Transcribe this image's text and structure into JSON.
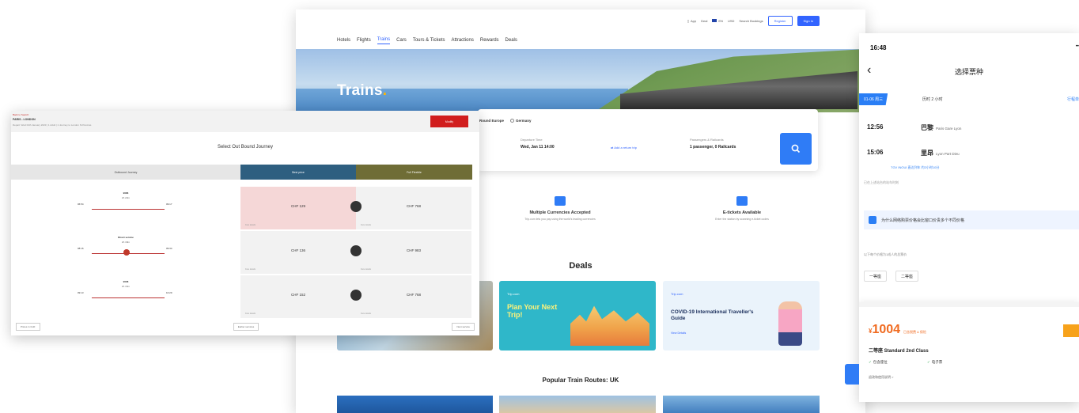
{
  "web": {
    "topbar": {
      "app_label": "App",
      "lang_label": "Deal",
      "currency_label": "EN",
      "usd_label": "USD",
      "search_label": "Search Bookings",
      "register_label": "Register",
      "signin_label": "Sign In"
    },
    "nav": [
      "Hotels",
      "Flights",
      "Trains",
      "Cars",
      "Tours & Tickets",
      "Attractions",
      "Rewards",
      "Deals"
    ],
    "hero": {
      "title": "Trains"
    },
    "search": {
      "radios": [
        "Round Europe",
        "Germany"
      ],
      "departure_label": "Departure Time",
      "departure_value": "Wed, Jan 11    14:00",
      "return_link": "Add a return trip",
      "passengers_label": "Passengers & Railcards",
      "passengers_value": "1 passenger, 0 Railcards"
    },
    "features": [
      {
        "title": "Multiple Currencies Accepted",
        "desc": "Trip.com lets you pay using the world's leading currencies"
      },
      {
        "title": "E-tickets Available",
        "desc": "Enter the station by scanning e-ticket codes"
      }
    ],
    "deals_title": "Deals",
    "deals": [
      {
        "tag": "Trip.com",
        "title": "Plan Your Next Trip!"
      },
      {
        "tag": "Trip.com",
        "title": "COVID-19 International Traveller's Guide",
        "more": "View Details"
      }
    ],
    "popular_title": "Popular Train Routes: UK"
  },
  "overlay": {
    "head_l1": "Back to Search",
    "head_l2": "PARIS - LONDON",
    "head_l3": "Depart: Wed 04th January 2023 | 1 Adult | 1 Journey to London St Pancras",
    "modify": "Modify",
    "title": "Select Out Bound Journey",
    "cols": [
      "Outbound Journey",
      "Best price",
      "Full Flexible"
    ],
    "rows": [
      {
        "name": "9086",
        "dur": "2h 23m",
        "dep": "06:54",
        "arr": "09:17",
        "fare1": "CHF 129",
        "fare2": "CHF 768"
      },
      {
        "name": "Direct service",
        "dur": "2h 18m",
        "dep": "08:16",
        "arr": "09:34",
        "fare1": "CHF 136",
        "fare2": "CHF 983"
      },
      {
        "name": "9008",
        "dur": "2h 16m",
        "dep": "09:13",
        "arr": "10:29",
        "fare1": "CHF 152",
        "fare2": "CHF 768"
      }
    ],
    "fare_foot": "Fare details",
    "foot": [
      "Prices in CHF",
      "Earlier services",
      "Next service"
    ]
  },
  "mobile": {
    "time": "16:48",
    "signal": "••• ",
    "title": "选择票种",
    "date": "01-06 周三",
    "date_info": "历时 2 小时",
    "date_right": "行程单",
    "dep_time": "12:56",
    "dep_station": "巴黎",
    "dep_station_en": "Paris Gare Lyon",
    "arr_time": "15:06",
    "arr_station": "里昂",
    "arr_station_en": "Lyon Part Dieu",
    "sub": "TGV  INOUI 直达列车 约2小时10分",
    "note": "已在上述站台的站车时刻",
    "banner": "为什么网络购票价格会比窗口价贵多个不同价格",
    "hint": "以下每个价格为1成人的总票价",
    "chips": [
      "一等座",
      "二等座"
    ],
    "price": "1004",
    "price_tag": "已含税费 & 保险",
    "seat": "二等座 Standard 2nd Class",
    "perks": [
      "包含座位",
      "电子票"
    ],
    "rule": "退改和使用说明 >"
  }
}
